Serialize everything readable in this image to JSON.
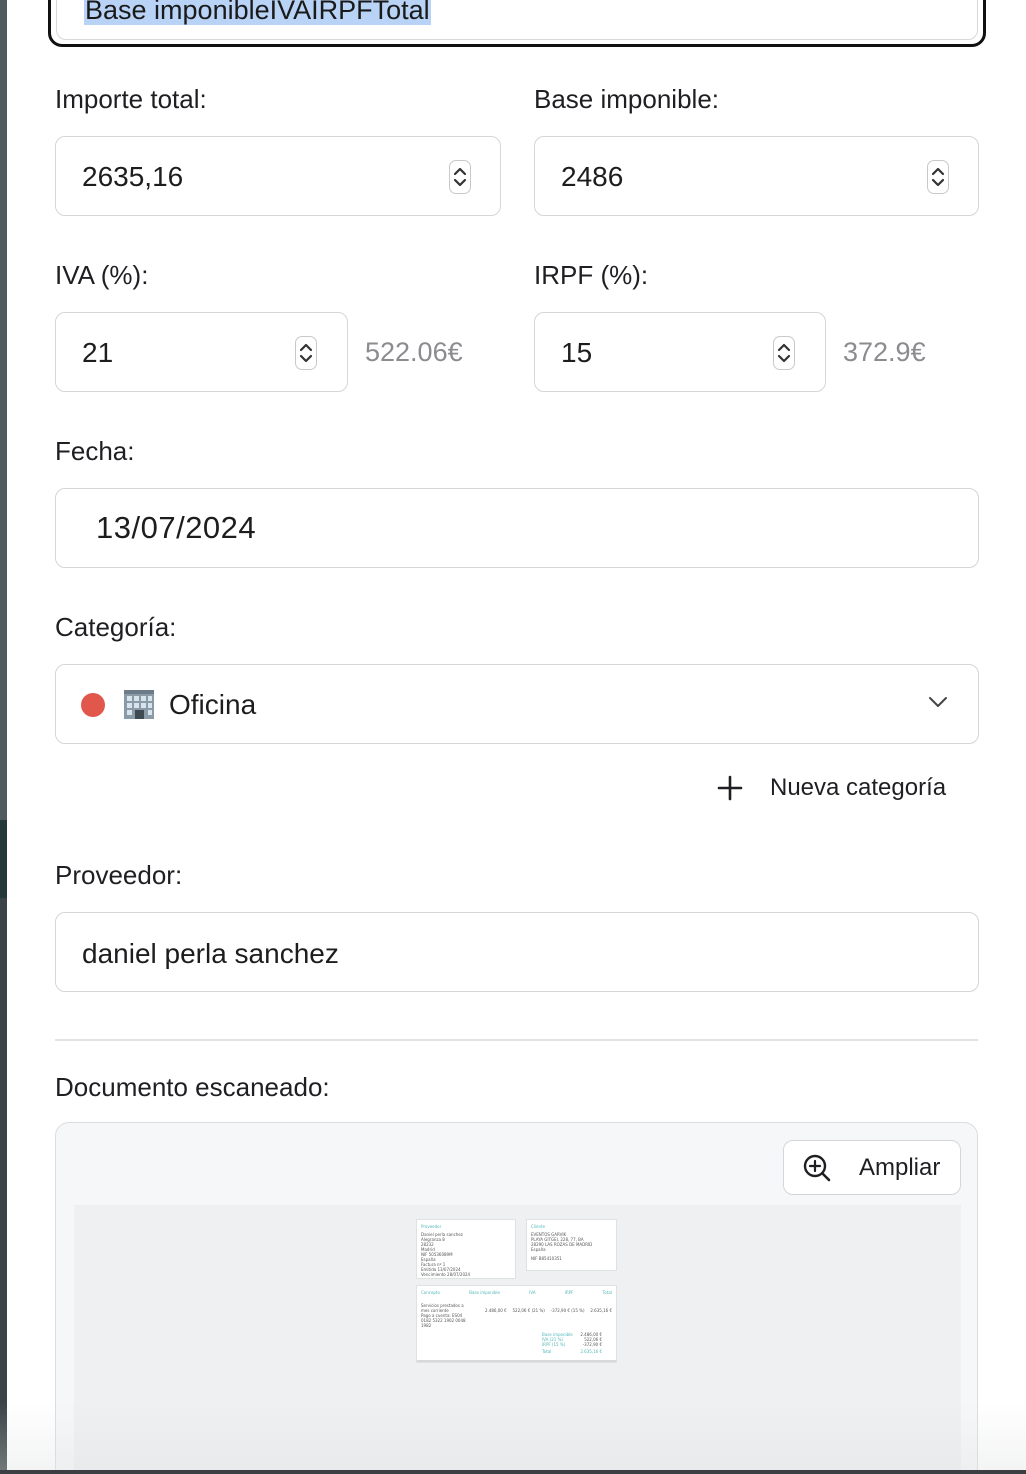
{
  "top_field": {
    "value": "Base imponibleIVAIRPFTotal"
  },
  "importe_total": {
    "label": "Importe total:",
    "value": "2635,16"
  },
  "base_imponible": {
    "label": "Base imponible:",
    "value": "2486"
  },
  "iva": {
    "label": "IVA (%):",
    "value": "21",
    "computed": "522.06€"
  },
  "irpf": {
    "label": "IRPF (%):",
    "value": "15",
    "computed": "372.9€"
  },
  "fecha": {
    "label": "Fecha:",
    "value": "13/07/2024"
  },
  "categoria": {
    "label": "Categoría:",
    "selected": "Oficina",
    "dot_color": "#e2574c",
    "icon": "office-building-icon"
  },
  "nueva_categoria": {
    "label": "Nueva categoría"
  },
  "proveedor": {
    "label": "Proveedor:",
    "value": "daniel perla sanchez"
  },
  "documento": {
    "label": "Documento escaneado:",
    "zoom_button": "Ampliar",
    "preview": {
      "proveedor_heading": "Proveedor",
      "proveedor_lines": [
        "Daniel perla sanchez",
        "Alegranza 8",
        "28232",
        "Madrid",
        "NIF 50536089M",
        "España",
        "Factura nº 1",
        "Emitida 13/07/2024",
        "Vencimiento 28/07/2024"
      ],
      "cliente_heading": "Cliente",
      "cliente_lines": [
        "EVENTOS GARVIK",
        "PLAYA GITGEI, 228, 77, BA",
        "28290 LAS ROZAS DE MADRID",
        "España",
        "NIF B85410351"
      ],
      "table_headers": [
        "Concepto",
        "Base imponible",
        "IVA",
        "IRPF",
        "Total"
      ],
      "row_concept": [
        "Servicios prestados a",
        "mes corriente",
        "Pago a cuenta: ES04",
        "0182 5322 1902 0048",
        "1982"
      ],
      "row_values": [
        "2.486,00 €",
        "522,06 € (21 %)",
        "-372,90 € (15 %)",
        "2.635,16 €"
      ],
      "summary": [
        {
          "k": "Base imponible",
          "v": "2.486,00 €"
        },
        {
          "k": "IVA (21 %)",
          "v": "522,06 €"
        },
        {
          "k": "IRPF (15 %)",
          "v": "-372,90 €"
        },
        {
          "k": "Total",
          "v": "2.635,16 €"
        }
      ]
    }
  }
}
